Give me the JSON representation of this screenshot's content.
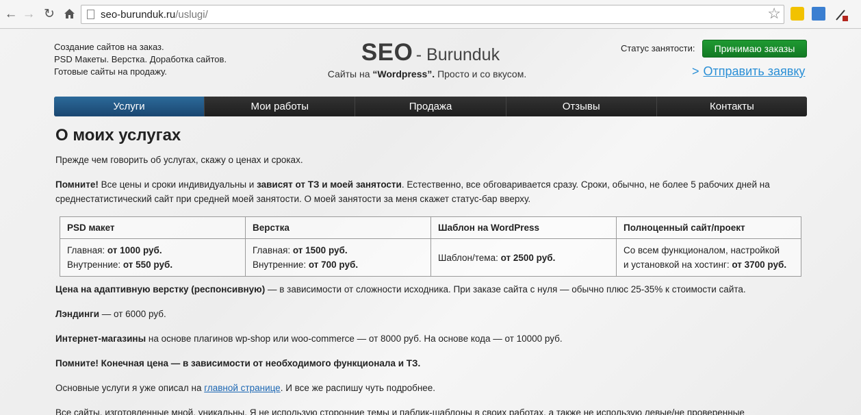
{
  "browser": {
    "url_host": "seo-burunduk.ru",
    "url_path": "/uslugi/"
  },
  "header": {
    "tagline": [
      "Создание сайтов на заказ.",
      "PSD Макеты. Верстка. Доработка сайтов.",
      "Готовые сайты на продажу."
    ],
    "logo_seo": "SEO",
    "logo_brand": "- Burunduk",
    "slogan_pre": "Сайты на ",
    "slogan_bold": "“Wordpress”.",
    "slogan_post": " Просто и со вкусом.",
    "status_label": "Статус занятости:",
    "status_button": "Принимаю заказы",
    "request_arrow": ">",
    "request_link": "Отправить заявку"
  },
  "menu": [
    "Услуги",
    "Мои работы",
    "Продажа",
    "Отзывы",
    "Контакты"
  ],
  "content": {
    "title": "О моих услугах",
    "intro": "Прежде чем говорить об услугах, скажу о ценах и сроках.",
    "note1_b1": "Помните!",
    "note1_t1": " Все цены и сроки индивидуальны и ",
    "note1_b2": "зависят от ТЗ и моей занятости",
    "note1_t2": ". Естественно, все обговаривается сразу. Сроки, обычно, не более 5 рабочих дней на среднестатистический сайт при средней моей занятости. О моей занятости за меня скажет статус-бар вверху.",
    "table": {
      "headers": [
        "PSD макет",
        "Верстка",
        "Шаблон на WordPress",
        "Полноценный сайт/проект"
      ],
      "c1_l1": "Главная: ",
      "c1_v1": "от 1000 руб.",
      "c1_l2": "Внутренние: ",
      "c1_v2": "от 550 руб.",
      "c2_l1": "Главная: ",
      "c2_v1": "от 1500 руб.",
      "c2_l2": "Внутренние: ",
      "c2_v2": "от 700 руб.",
      "c3_l1": "Шаблон/тема: ",
      "c3_v1": "от 2500 руб.",
      "c4_l1": "Со всем функционалом, настройкой",
      "c4_l2": "и установкой на хостинг: ",
      "c4_v2": "от 3700 руб."
    },
    "adaptive_b": "Цена на адаптивную верстку (респонсивную)",
    "adaptive_t": " — в зависимости от сложности исходника. При заказе сайта с нуля — обычно плюс 25-35% к стоимости сайта.",
    "landing_b": "Лэндинги",
    "landing_t": " — от 6000 руб.",
    "shop_b": "Интернет-магазины",
    "shop_t": " на основе плагинов wp-shop или woo-commerce — от 8000 руб. На основе кода — от 10000 руб.",
    "note2": "Помните! Конечная цена — в зависимости от необходимого функционала и ТЗ.",
    "services_t1": "Основные услуги я уже описал на ",
    "services_link": "главной странице",
    "services_t2": ". И все же распишу чуть подробнее.",
    "last_line": "Все сайты, изготовленные мной, уникальны. Я не использую сторонние темы и паблик-шаблоны в своих работах, а также не использую левые/не проверенные"
  }
}
